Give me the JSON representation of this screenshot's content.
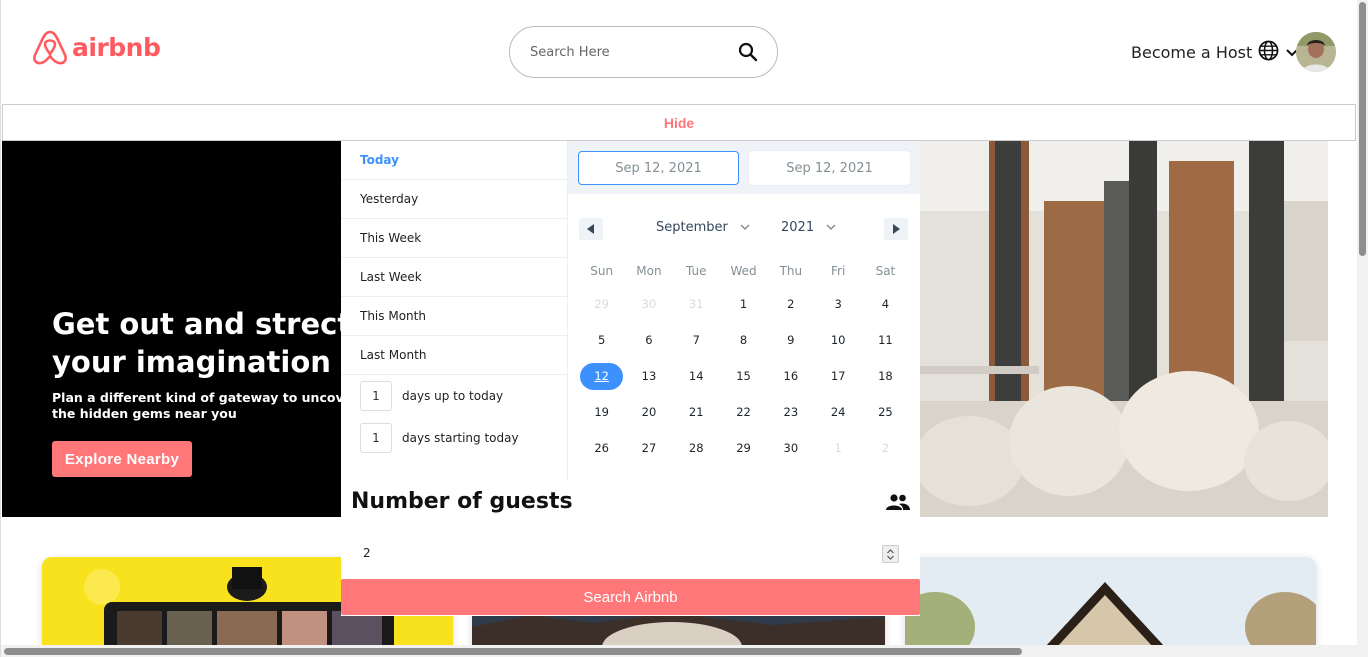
{
  "header": {
    "logo_text": "airbnb",
    "search_placeholder": "Search Here",
    "host_label": "Become a Host"
  },
  "hide_bar": {
    "label": "Hide"
  },
  "banner": {
    "title": "Get out and strect your imagination",
    "subtitle": "Plan a different kind of gateway to uncover the hidden gems near you",
    "explore_label": "Explore Nearby"
  },
  "date_picker": {
    "static_ranges": [
      "Today",
      "Yesterday",
      "This Week",
      "Last Week",
      "This Month",
      "Last Month"
    ],
    "active_range": "Today",
    "input_ranges": [
      {
        "value": "1",
        "label": "days up to today"
      },
      {
        "value": "1",
        "label": "days starting today"
      }
    ],
    "start_date": "Sep 12, 2021",
    "end_date": "Sep 12, 2021",
    "month": "September",
    "year": "2021",
    "weekdays": [
      "Sun",
      "Mon",
      "Tue",
      "Wed",
      "Thu",
      "Fri",
      "Sat"
    ],
    "days": [
      {
        "d": "29",
        "passive": true
      },
      {
        "d": "30",
        "passive": true
      },
      {
        "d": "31",
        "passive": true
      },
      {
        "d": "1"
      },
      {
        "d": "2"
      },
      {
        "d": "3"
      },
      {
        "d": "4"
      },
      {
        "d": "5"
      },
      {
        "d": "6"
      },
      {
        "d": "7"
      },
      {
        "d": "8"
      },
      {
        "d": "9"
      },
      {
        "d": "10"
      },
      {
        "d": "11"
      },
      {
        "d": "12",
        "selected": true
      },
      {
        "d": "13"
      },
      {
        "d": "14"
      },
      {
        "d": "15"
      },
      {
        "d": "16"
      },
      {
        "d": "17"
      },
      {
        "d": "18"
      },
      {
        "d": "19"
      },
      {
        "d": "20"
      },
      {
        "d": "21"
      },
      {
        "d": "22"
      },
      {
        "d": "23"
      },
      {
        "d": "24"
      },
      {
        "d": "25"
      },
      {
        "d": "26"
      },
      {
        "d": "27"
      },
      {
        "d": "28"
      },
      {
        "d": "29"
      },
      {
        "d": "30"
      },
      {
        "d": "1",
        "passive": true
      },
      {
        "d": "2",
        "passive": true
      }
    ]
  },
  "guests": {
    "title": "Number of guests",
    "value": "2",
    "search_label": "Search Airbnb"
  },
  "colors": {
    "brand": "#ff5a5f",
    "accent_pink": "#ff7779",
    "picker_blue": "#3d91ff"
  }
}
